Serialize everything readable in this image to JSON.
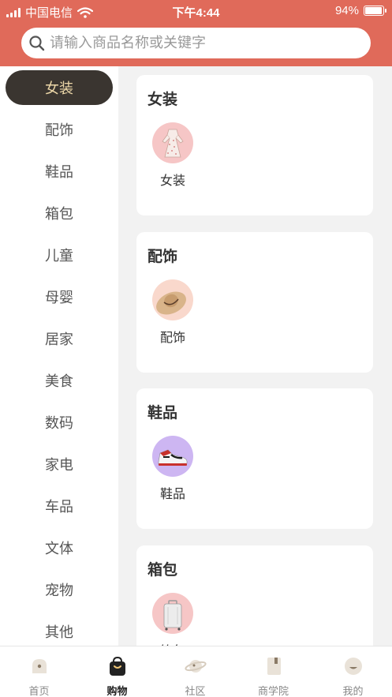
{
  "status_bar": {
    "carrier": "中国电信",
    "time": "下午4:44",
    "battery": "94%",
    "battery_level": 0.94
  },
  "search": {
    "placeholder": "请输入商品名称或关键字"
  },
  "sidebar": {
    "items": [
      {
        "label": "女装",
        "active": true
      },
      {
        "label": "配饰"
      },
      {
        "label": "鞋品"
      },
      {
        "label": "箱包"
      },
      {
        "label": "儿童"
      },
      {
        "label": "母婴"
      },
      {
        "label": "居家"
      },
      {
        "label": "美食"
      },
      {
        "label": "数码"
      },
      {
        "label": "家电"
      },
      {
        "label": "车品"
      },
      {
        "label": "文体"
      },
      {
        "label": "宠物"
      },
      {
        "label": "其他"
      }
    ]
  },
  "sections": [
    {
      "title": "女装",
      "item_label": "女装",
      "icon": "dress-icon",
      "bg": "#f6c6c6"
    },
    {
      "title": "配饰",
      "item_label": "配饰",
      "icon": "sun-hat-icon",
      "bg": "#f9d8cc"
    },
    {
      "title": "鞋品",
      "item_label": "鞋品",
      "icon": "sneaker-icon",
      "bg": "#cdb6f2"
    },
    {
      "title": "箱包",
      "item_label": "箱包",
      "icon": "suitcase-icon",
      "bg": "#f6c6c6"
    }
  ],
  "tabbar": {
    "tabs": [
      {
        "label": "首页",
        "icon": "home-icon"
      },
      {
        "label": "购物",
        "icon": "shopping-bag-icon",
        "active": true
      },
      {
        "label": "社区",
        "icon": "planet-icon"
      },
      {
        "label": "商学院",
        "icon": "book-icon"
      },
      {
        "label": "我的",
        "icon": "profile-icon"
      }
    ]
  },
  "colors": {
    "header": "#e06a5a",
    "sidebar_active_bg": "#3a3530",
    "sidebar_active_text": "#ecd7a8"
  }
}
